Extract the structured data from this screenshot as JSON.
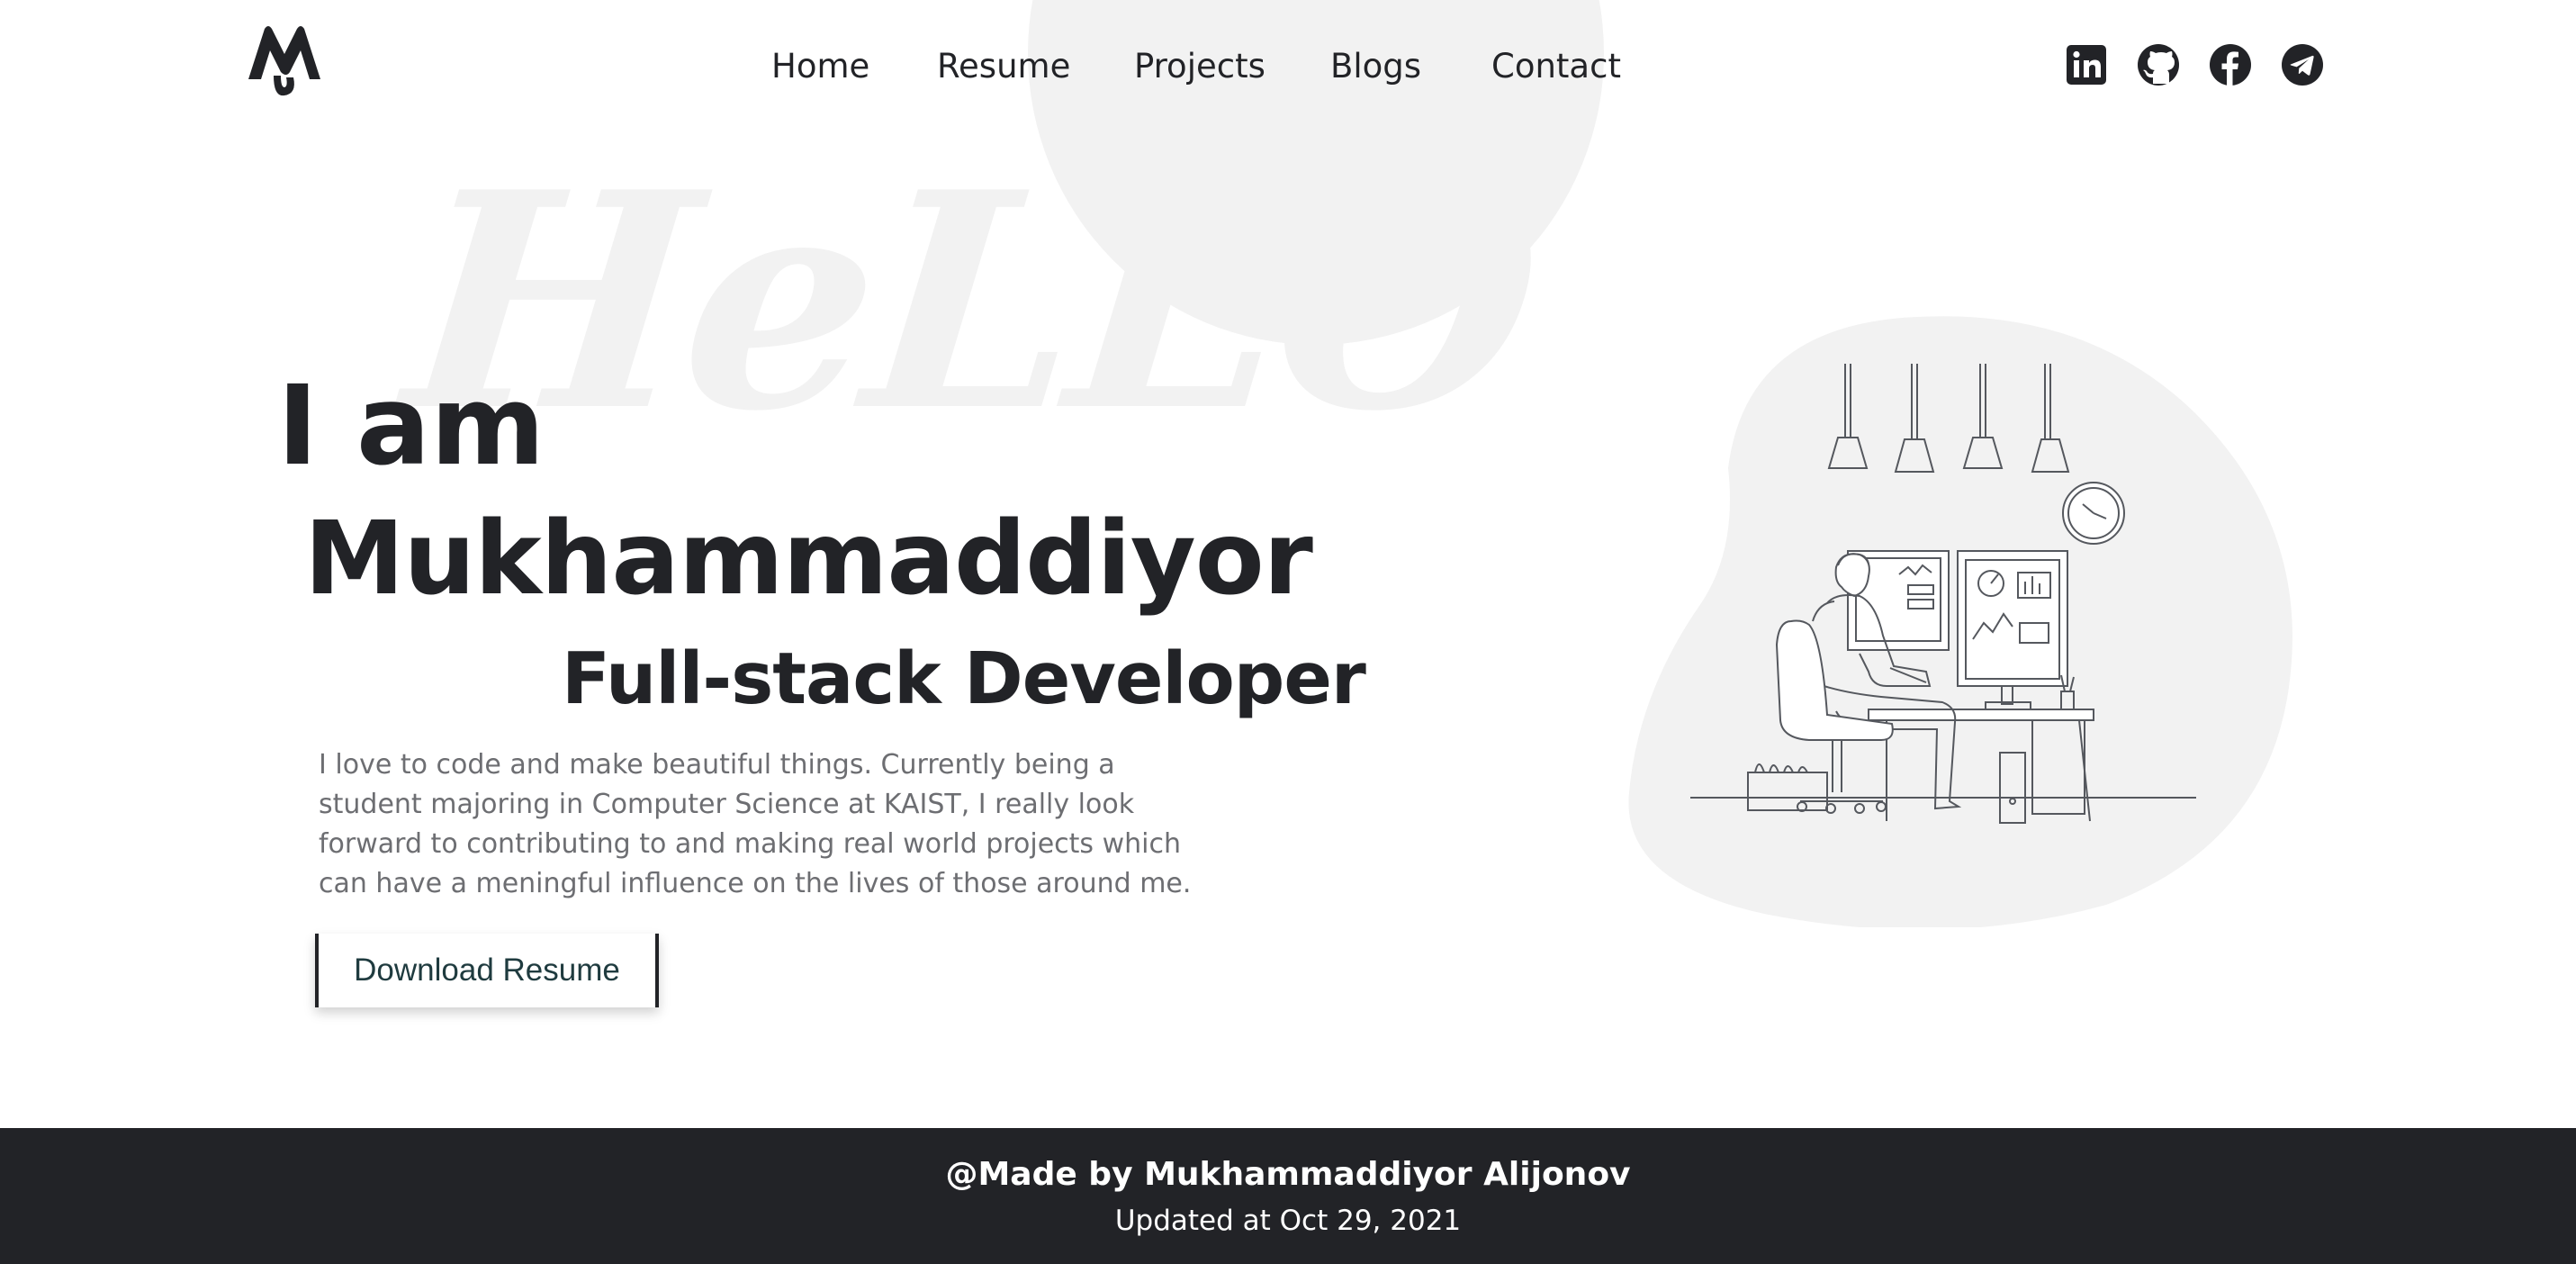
{
  "header": {
    "logo_icon": "initials-logo-icon",
    "nav": [
      {
        "label": "Home"
      },
      {
        "label": "Resume"
      },
      {
        "label": "Projects"
      },
      {
        "label": "Blogs"
      },
      {
        "label": "Contact"
      }
    ],
    "social_icons": [
      "linkedin-icon",
      "github-icon",
      "facebook-icon",
      "telegram-icon"
    ]
  },
  "hero": {
    "watermark": "HeLLO",
    "line1": "I am",
    "name": "Mukhammaddiyor",
    "role": "Full-stack Developer",
    "description": "I love to code and make beautiful things. Currently being a student majoring in Computer Science at KAIST, I really look forward to contributing to and making real world projects which can have a meningful influence on the lives of those around me.",
    "download_label": "Download Resume"
  },
  "illustration": {
    "icon": "developer-at-desk-illustration"
  },
  "footer": {
    "credit": "@Made by Mukhammaddiyor Alijonov",
    "updated": "Updated at Oct 29, 2021"
  },
  "colors": {
    "text": "#222327",
    "muted": "#6d6e72",
    "decor": "#f2f2f2",
    "footer_bg": "#222327"
  }
}
